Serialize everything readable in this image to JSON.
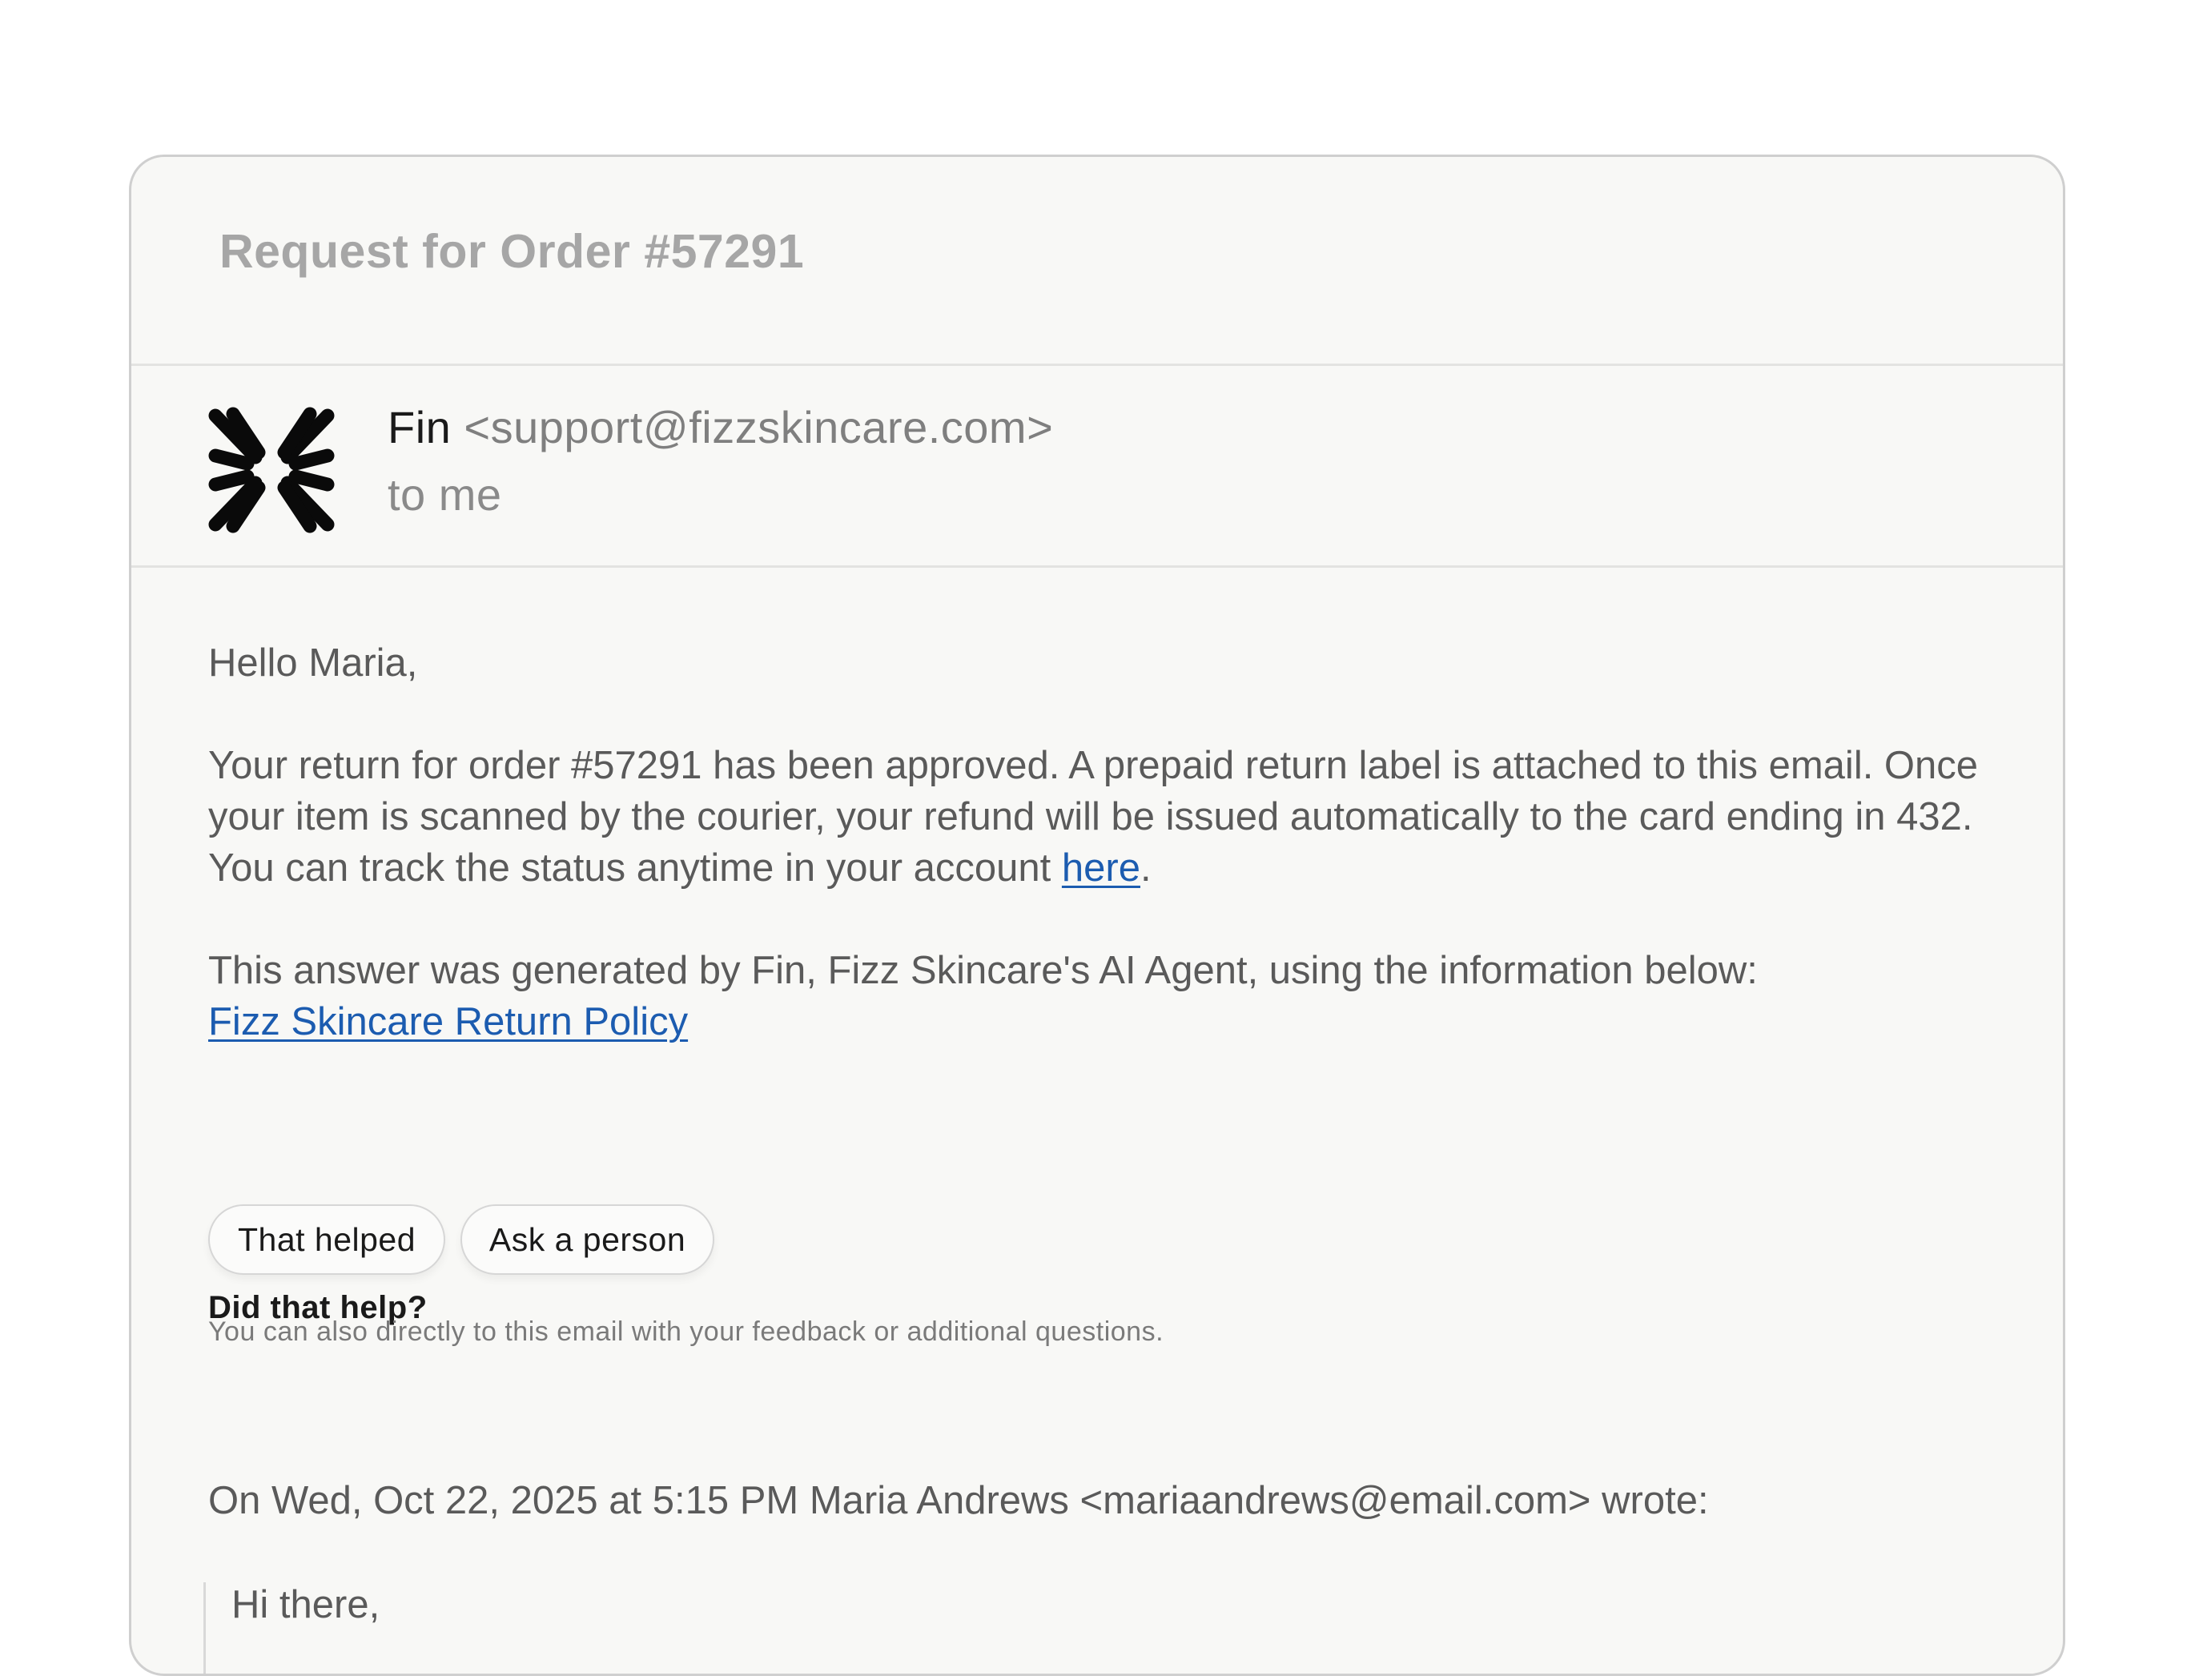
{
  "email": {
    "subject": "Request for Order #57291",
    "sender": {
      "name": "Fin",
      "address": "<support@fizzskincare.com>",
      "logo_icon": "fizz-logo-icon"
    },
    "recipient": "to me",
    "greeting": "Hello Maria,",
    "para1": {
      "text": "Your return for order #57291 has been approved. A prepaid return label is attached to this email. Once your item is scanned by the courier, your refund will be issued automatically to the card ending in 432. You can track the status anytime in your account ",
      "link_label": "here",
      "tail": "."
    },
    "para2": {
      "text": "This answer was generated by Fin, Fizz Skincare's AI Agent, using the information below:",
      "link_label": "Fizz Skincare Return Policy"
    },
    "feedback": {
      "title": "Did that help?",
      "buttons": {
        "helped": "That helped",
        "ask_person": "Ask a person"
      },
      "hint": "You can also directly to this email with your feedback or additional questions."
    },
    "quoted": {
      "header": "On Wed, Oct 22, 2025 at 5:15 PM Maria Andrews <mariaandrews@email.com> wrote:",
      "first_line": "Hi there,"
    }
  },
  "colors": {
    "card_bg": "#f8f8f6",
    "link": "#1c5cb0",
    "subject": "#a6a6a6",
    "body_text": "#5a5a5a"
  }
}
